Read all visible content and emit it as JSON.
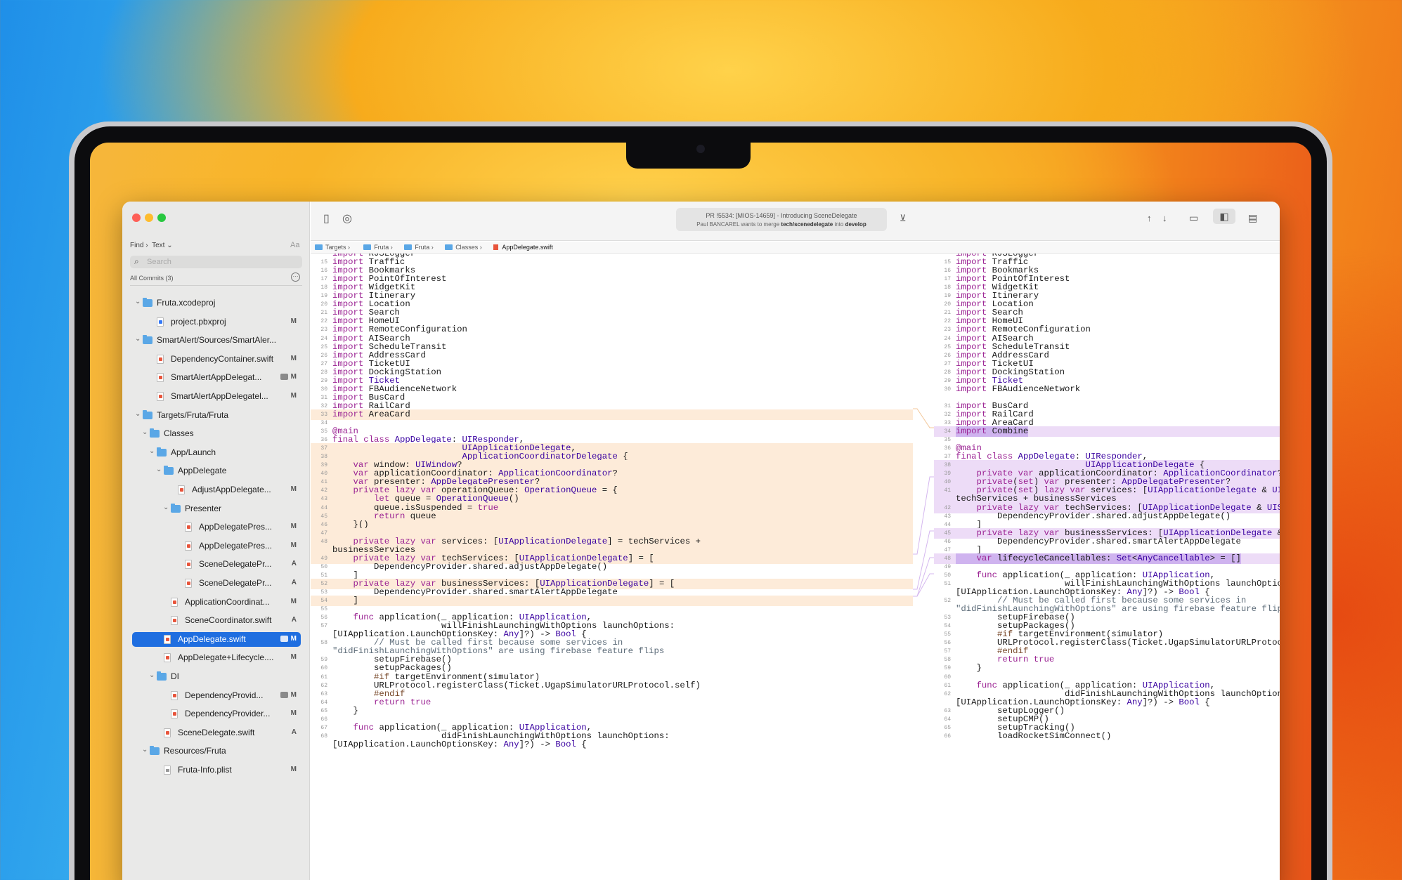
{
  "window": {
    "pr_title": "PR !5534: [MIOS-14659] - Introducing SceneDelegate",
    "pr_sub_pre": "Paul BANCAREL wants to merge ",
    "pr_sub_src": "tech/scenedelegate",
    "pr_sub_mid": " into ",
    "pr_sub_dst": "develop"
  },
  "sidebar": {
    "find_label": "Find ›",
    "find_mode": "Text ⌄",
    "aa": "Aa",
    "search_placeholder": "Search",
    "commits_label": "All Commits (3)",
    "tree": [
      {
        "label": "Fruta.xcodeproj",
        "kind": "folder",
        "depth": 0,
        "open": true,
        "badge": ""
      },
      {
        "label": "project.pbxproj",
        "kind": "pbx",
        "depth": 2,
        "badge": "M"
      },
      {
        "label": "SmartAlert/Sources/SmartAler...",
        "kind": "folder",
        "depth": 0,
        "open": true,
        "badge": ""
      },
      {
        "label": "DependencyContainer.swift",
        "kind": "swift",
        "depth": 2,
        "badge": "M"
      },
      {
        "label": "SmartAlertAppDelegat...",
        "kind": "swift",
        "depth": 2,
        "badge": "M",
        "comment": true
      },
      {
        "label": "SmartAlertAppDelegatel...",
        "kind": "swift",
        "depth": 2,
        "badge": "M"
      },
      {
        "label": "Targets/Fruta/Fruta",
        "kind": "folder",
        "depth": 0,
        "open": true,
        "badge": ""
      },
      {
        "label": "Classes",
        "kind": "folder",
        "depth": 1,
        "open": true,
        "badge": ""
      },
      {
        "label": "App/Launch",
        "kind": "folder",
        "depth": 2,
        "open": true,
        "badge": ""
      },
      {
        "label": "AppDelegate",
        "kind": "folder",
        "depth": 3,
        "open": true,
        "badge": ""
      },
      {
        "label": "AdjustAppDelegate...",
        "kind": "swift",
        "depth": 5,
        "badge": "M"
      },
      {
        "label": "Presenter",
        "kind": "folder",
        "depth": 4,
        "open": true,
        "badge": ""
      },
      {
        "label": "AppDelegatePres...",
        "kind": "swift",
        "depth": 6,
        "badge": "M"
      },
      {
        "label": "AppDelegatePres...",
        "kind": "swift",
        "depth": 6,
        "badge": "M"
      },
      {
        "label": "SceneDelegatePr...",
        "kind": "swift",
        "depth": 6,
        "badge": "A"
      },
      {
        "label": "SceneDelegatePr...",
        "kind": "swift",
        "depth": 6,
        "badge": "A"
      },
      {
        "label": "ApplicationCoordinat...",
        "kind": "swift",
        "depth": 4,
        "badge": "M"
      },
      {
        "label": "SceneCoordinator.swift",
        "kind": "swift",
        "depth": 4,
        "badge": "A"
      },
      {
        "label": "AppDelegate.swift",
        "kind": "swift",
        "depth": 3,
        "badge": "M",
        "comment": true,
        "selected": true
      },
      {
        "label": "AppDelegate+Lifecycle....",
        "kind": "swift",
        "depth": 3,
        "badge": "M"
      },
      {
        "label": "DI",
        "kind": "folder",
        "depth": 2,
        "open": true,
        "badge": ""
      },
      {
        "label": "DependencyProvid...",
        "kind": "swift",
        "depth": 4,
        "badge": "M",
        "comment": true
      },
      {
        "label": "DependencyProvider...",
        "kind": "swift",
        "depth": 4,
        "badge": "M"
      },
      {
        "label": "SceneDelegate.swift",
        "kind": "swift",
        "depth": 3,
        "badge": "A"
      },
      {
        "label": "Resources/Fruta",
        "kind": "folder",
        "depth": 1,
        "open": true,
        "badge": ""
      },
      {
        "label": "Fruta-Info.plist",
        "kind": "plist",
        "depth": 3,
        "badge": "M"
      }
    ]
  },
  "breadcrumbs": [
    "Targets",
    "Fruta",
    "Fruta",
    "Classes",
    "AppDelegate.swift"
  ],
  "icons": {
    "sidebar_toggle": "book-icon",
    "navigate": "compass-icon",
    "download": "tray-icon",
    "up": "arrow-up-icon",
    "down": "arrow-down-icon",
    "layout1": "layout-bottom-icon",
    "layout2": "layout-split-icon",
    "layout3": "layout-inspector-icon"
  },
  "left_code": [
    {
      "n": "",
      "t": "import RJSLogger",
      "cut": true
    },
    {
      "n": "15",
      "t": "import Traffic"
    },
    {
      "n": "16",
      "t": "import Bookmarks"
    },
    {
      "n": "17",
      "t": "import PointOfInterest"
    },
    {
      "n": "18",
      "t": "import WidgetKit"
    },
    {
      "n": "19",
      "t": "import Itinerary"
    },
    {
      "n": "20",
      "t": "import Location"
    },
    {
      "n": "21",
      "t": "import Search"
    },
    {
      "n": "22",
      "t": "import HomeUI"
    },
    {
      "n": "23",
      "t": "import RemoteConfiguration"
    },
    {
      "n": "24",
      "t": "import AISearch"
    },
    {
      "n": "25",
      "t": "import ScheduleTransit"
    },
    {
      "n": "26",
      "t": "import AddressCard"
    },
    {
      "n": "27",
      "t": "import TicketUI"
    },
    {
      "n": "28",
      "t": "import DockingStation"
    },
    {
      "n": "29",
      "t": "import Ticket"
    },
    {
      "n": "30",
      "t": "import FBAudienceNetwork"
    },
    {
      "n": "31",
      "t": "import BusCard"
    },
    {
      "n": "32",
      "t": "import RailCard"
    },
    {
      "n": "33",
      "t": "import AreaCard",
      "hl": "o"
    },
    {
      "n": "34",
      "t": ""
    },
    {
      "n": "35",
      "t": "@main"
    },
    {
      "n": "36",
      "t": "final class AppDelegate: UIResponder,"
    },
    {
      "n": "37",
      "t": "                         UIApplicationDelegate,",
      "hl": "o"
    },
    {
      "n": "38",
      "t": "                         ApplicationCoordinatorDelegate {",
      "hl": "o"
    },
    {
      "n": "39",
      "t": "    var window: UIWindow?",
      "hl": "o"
    },
    {
      "n": "40",
      "t": "    var applicationCoordinator: ApplicationCoordinator?",
      "hl": "o"
    },
    {
      "n": "41",
      "t": "    var presenter: AppDelegatePresenter?",
      "hl": "o"
    },
    {
      "n": "42",
      "t": "    private lazy var operationQueue: OperationQueue = {",
      "hl": "o"
    },
    {
      "n": "43",
      "t": "        let queue = OperationQueue()",
      "hl": "o"
    },
    {
      "n": "44",
      "t": "        queue.isSuspended = true",
      "hl": "o"
    },
    {
      "n": "45",
      "t": "        return queue",
      "hl": "o"
    },
    {
      "n": "46",
      "t": "    }()",
      "hl": "o"
    },
    {
      "n": "47",
      "t": "",
      "hl": "o"
    },
    {
      "n": "48",
      "t": "    private lazy var services: [UIApplicationDelegate] = techServices +",
      "hl": "o"
    },
    {
      "n": "",
      "t": "businessServices",
      "hl": "o"
    },
    {
      "n": "49",
      "t": "    private lazy var techServices: [UIApplicationDelegate] = [",
      "hl": "o"
    },
    {
      "n": "50",
      "t": "        DependencyProvider.shared.adjustAppDelegate()"
    },
    {
      "n": "51",
      "t": "    ]"
    },
    {
      "n": "52",
      "t": "    private lazy var businessServices: [UIApplicationDelegate] = [",
      "hl": "o"
    },
    {
      "n": "53",
      "t": "        DependencyProvider.shared.smartAlertAppDelegate"
    },
    {
      "n": "54",
      "t": "    ]",
      "hl": "o"
    },
    {
      "n": "55",
      "t": ""
    },
    {
      "n": "56",
      "t": "    func application(_ application: UIApplication,"
    },
    {
      "n": "57",
      "t": "                     willFinishLaunchingWithOptions launchOptions:"
    },
    {
      "n": "",
      "t": "[UIApplication.LaunchOptionsKey: Any]?) -> Bool {"
    },
    {
      "n": "58",
      "t": "        // Must be called first because some services in"
    },
    {
      "n": "",
      "t": "\"didFinishLaunchingWithOptions\" are using firebase feature flips"
    },
    {
      "n": "59",
      "t": "        setupFirebase()"
    },
    {
      "n": "60",
      "t": "        setupPackages()"
    },
    {
      "n": "61",
      "t": "        #if targetEnvironment(simulator)"
    },
    {
      "n": "62",
      "t": "        URLProtocol.registerClass(Ticket.UgapSimulatorURLProtocol.self)"
    },
    {
      "n": "63",
      "t": "        #endif"
    },
    {
      "n": "64",
      "t": "        return true"
    },
    {
      "n": "65",
      "t": "    }"
    },
    {
      "n": "66",
      "t": ""
    },
    {
      "n": "67",
      "t": "    func application(_ application: UIApplication,"
    },
    {
      "n": "68",
      "t": "                     didFinishLaunchingWithOptions launchOptions:"
    },
    {
      "n": "",
      "t": "[UIApplication.LaunchOptionsKey: Any]?) -> Bool {"
    }
  ],
  "right_code": [
    {
      "n": "",
      "t": "import RJSLogger",
      "cut": true
    },
    {
      "n": "15",
      "t": "import Traffic"
    },
    {
      "n": "16",
      "t": "import Bookmarks"
    },
    {
      "n": "17",
      "t": "import PointOfInterest"
    },
    {
      "n": "18",
      "t": "import WidgetKit"
    },
    {
      "n": "19",
      "t": "import Itinerary"
    },
    {
      "n": "20",
      "t": "import Location"
    },
    {
      "n": "21",
      "t": "import Search"
    },
    {
      "n": "22",
      "t": "import HomeUI"
    },
    {
      "n": "23",
      "t": "import RemoteConfiguration"
    },
    {
      "n": "24",
      "t": "import AISearch"
    },
    {
      "n": "25",
      "t": "import ScheduleTransit"
    },
    {
      "n": "26",
      "t": "import AddressCard"
    },
    {
      "n": "27",
      "t": "import TicketUI"
    },
    {
      "n": "28",
      "t": "import DockingStation"
    },
    {
      "n": "29",
      "t": "import Ticket"
    },
    {
      "n": "30",
      "t": "import FBAudienceNetwork"
    },
    {
      "n": "",
      "t": "",
      "gap": true
    },
    {
      "n": "31",
      "t": "import BusCard"
    },
    {
      "n": "32",
      "t": "import RailCard"
    },
    {
      "n": "33",
      "t": "import AreaCard"
    },
    {
      "n": "34",
      "t": "import Combine",
      "hl": "p",
      "mark": "pb-all"
    },
    {
      "n": "35",
      "t": ""
    },
    {
      "n": "36",
      "t": "@main"
    },
    {
      "n": "37",
      "t": "final class AppDelegate: UIResponder,"
    },
    {
      "n": "38",
      "t": "                         UIApplicationDelegate {",
      "hl": "p"
    },
    {
      "n": "39",
      "t": "    private var applicationCoordinator: ApplicationCoordinator?",
      "hl": "p",
      "mark": "private"
    },
    {
      "n": "40",
      "t": "    private(set) var presenter: AppDelegatePresenter?",
      "hl": "p",
      "mark": "private(set)"
    },
    {
      "n": "41",
      "t": "    private(set) lazy var services: [UIApplicationDelegate & UISceneDelegate] =",
      "hl": "p"
    },
    {
      "n": "",
      "t": "techServices + businessServices",
      "hl": "p"
    },
    {
      "n": "42",
      "t": "    private lazy var techServices: [UIApplicationDelegate & UISceneDelegate] = [",
      "hl": "p"
    },
    {
      "n": "43",
      "t": "        DependencyProvider.shared.adjustAppDelegate()"
    },
    {
      "n": "44",
      "t": "    ]"
    },
    {
      "n": "45",
      "t": "    private lazy var businessServices: [UIApplicationDelegate & UISceneDelegate] = [",
      "hl": "p"
    },
    {
      "n": "46",
      "t": "        DependencyProvider.shared.smartAlertAppDelegate"
    },
    {
      "n": "47",
      "t": "    ]"
    },
    {
      "n": "48",
      "t": "    var lifecycleCancellables: Set<AnyCancellable> = []",
      "hl": "p",
      "mark": "pb-all"
    },
    {
      "n": "49",
      "t": ""
    },
    {
      "n": "50",
      "t": "    func application(_ application: UIApplication,"
    },
    {
      "n": "51",
      "t": "                     willFinishLaunchingWithOptions launchOptions:"
    },
    {
      "n": "",
      "t": "[UIApplication.LaunchOptionsKey: Any]?) -> Bool {"
    },
    {
      "n": "52",
      "t": "        // Must be called first because some services in"
    },
    {
      "n": "",
      "t": "\"didFinishLaunchingWithOptions\" are using firebase feature flips"
    },
    {
      "n": "53",
      "t": "        setupFirebase()"
    },
    {
      "n": "54",
      "t": "        setupPackages()"
    },
    {
      "n": "55",
      "t": "        #if targetEnvironment(simulator)"
    },
    {
      "n": "56",
      "t": "        URLProtocol.registerClass(Ticket.UgapSimulatorURLProtocol.self)"
    },
    {
      "n": "57",
      "t": "        #endif"
    },
    {
      "n": "58",
      "t": "        return true"
    },
    {
      "n": "59",
      "t": "    }"
    },
    {
      "n": "60",
      "t": ""
    },
    {
      "n": "61",
      "t": "    func application(_ application: UIApplication,"
    },
    {
      "n": "62",
      "t": "                     didFinishLaunchingWithOptions launchOptions:"
    },
    {
      "n": "",
      "t": "[UIApplication.LaunchOptionsKey: Any]?) -> Bool {"
    },
    {
      "n": "63",
      "t": "        setupLogger()"
    },
    {
      "n": "64",
      "t": "        setupCMP()"
    },
    {
      "n": "65",
      "t": "        setupTracking()"
    },
    {
      "n": "66",
      "t": "        loadRocketSimConnect()"
    }
  ],
  "colors": {
    "selection": "#1f6ee0",
    "removed": "#fdebd9",
    "added": "#eddcf7"
  }
}
